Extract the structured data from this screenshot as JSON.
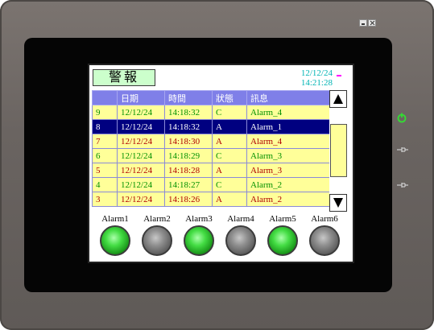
{
  "header": {
    "title": "警報",
    "date": "12/12/24",
    "time": "14:21:28"
  },
  "table": {
    "columns": [
      "",
      "日期",
      "時間",
      "狀態",
      "訊息"
    ],
    "rows": [
      {
        "no": "9",
        "date": "12/12/24",
        "time": "14:18:32",
        "status": "C",
        "message": "Alarm_4",
        "selected": false
      },
      {
        "no": "8",
        "date": "12/12/24",
        "time": "14:18:32",
        "status": "A",
        "message": "Alarm_1",
        "selected": true
      },
      {
        "no": "7",
        "date": "12/12/24",
        "time": "14:18:30",
        "status": "A",
        "message": "Alarm_4",
        "selected": false
      },
      {
        "no": "6",
        "date": "12/12/24",
        "time": "14:18:29",
        "status": "C",
        "message": "Alarm_3",
        "selected": false
      },
      {
        "no": "5",
        "date": "12/12/24",
        "time": "14:18:28",
        "status": "A",
        "message": "Alarm_3",
        "selected": false
      },
      {
        "no": "4",
        "date": "12/12/24",
        "time": "14:18:27",
        "status": "C",
        "message": "Alarm_2",
        "selected": false
      },
      {
        "no": "3",
        "date": "12/12/24",
        "time": "14:18:26",
        "status": "A",
        "message": "Alarm_2",
        "selected": false
      }
    ]
  },
  "alarms": [
    {
      "label": "Alarm1",
      "state": "on"
    },
    {
      "label": "Alarm2",
      "state": "off"
    },
    {
      "label": "Alarm3",
      "state": "on"
    },
    {
      "label": "Alarm4",
      "state": "off"
    },
    {
      "label": "Alarm5",
      "state": "on"
    },
    {
      "label": "Alarm6",
      "state": "off"
    }
  ],
  "colors": {
    "row_bg": "#ffff99",
    "header_bg": "#7f7fe8",
    "selected_bg": "#000080",
    "status_active": "#b00000",
    "status_cleared": "#009000",
    "lamp_on": "#44dd44",
    "lamp_off": "#8f8f8f",
    "datetime": "#00b4b4"
  },
  "icons": {
    "window_minimize": "minimize-icon",
    "window_close": "close-icon",
    "scroll_up": "arrow-up-icon",
    "scroll_down": "arrow-down-icon",
    "power": "power-icon",
    "side_a": "plug-icon",
    "side_b": "plug-icon"
  }
}
